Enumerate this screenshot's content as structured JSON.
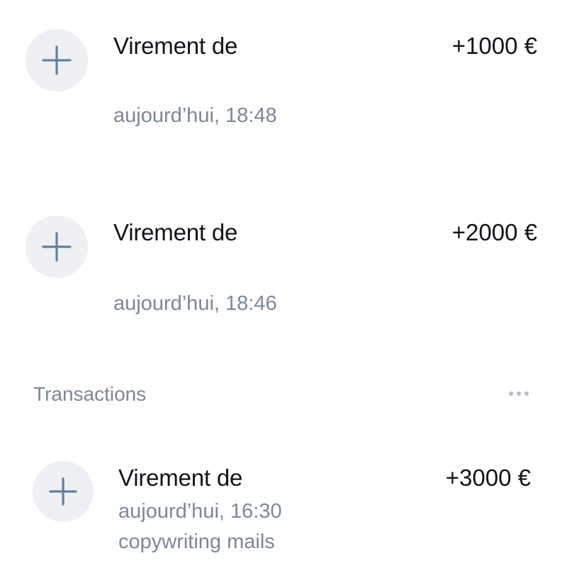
{
  "transactions_pending": [
    {
      "title": "Virement de",
      "amount": "+1000 €",
      "date": "aujourd’hui, 18:48",
      "icon": "plus-icon"
    },
    {
      "title": "Virement de",
      "amount": "+2000 €",
      "date": "aujourd’hui, 18:46",
      "icon": "plus-icon"
    }
  ],
  "section": {
    "title": "Transactions",
    "more_icon": "more-icon"
  },
  "transactions": [
    {
      "title": "Virement de",
      "amount": "+3000 €",
      "date": "aujourd’hui, 16:30",
      "note": "copywriting mails",
      "icon": "plus-icon"
    }
  ],
  "colors": {
    "icon_background": "#eef0f4",
    "icon_stroke": "#62809e",
    "secondary_text": "#7d8894",
    "primary_text": "#111418"
  }
}
